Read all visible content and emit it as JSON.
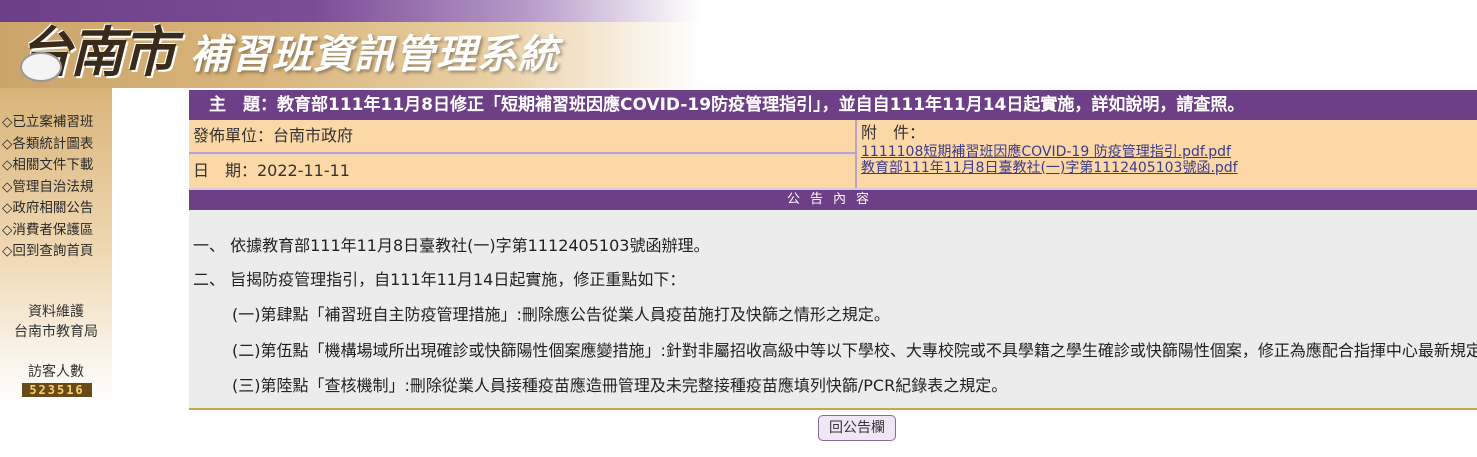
{
  "header": {
    "city_logo": "台南市",
    "system_title": "補習班資訊管理系統"
  },
  "sidebar": {
    "items": [
      {
        "label": "◇已立案補習班"
      },
      {
        "label": "◇各類統計圖表"
      },
      {
        "label": "◇相關文件下載"
      },
      {
        "label": "◇管理自治法規"
      },
      {
        "label": "◇政府相關公告"
      },
      {
        "label": "◇消費者保護區"
      },
      {
        "label": "◇回到查詢首頁"
      }
    ],
    "maintainer_label": "資料維護",
    "maintainer_name": "台南市教育局",
    "visitor_label": "訪客人數",
    "visitor_count": "523516"
  },
  "announcement": {
    "subject": "主　題：教育部111年11月8日修正「短期補習班因應COVID-19防疫管理指引」，並自自111年11月14日起實施，詳如說明，請查照。",
    "publisher": "發佈單位：台南市政府",
    "date": "日　期：2022-11-11",
    "attachment_label": "附　件：",
    "attachments": [
      "1111108短期補習班因應COVID-19 防疫管理指引.pdf.pdf",
      "教育部111年11月8日臺教社(一)字第1112405103號函.pdf"
    ],
    "content_header": "公告內容",
    "paragraphs": [
      "一、 依據教育部111年11月8日臺教社(一)字第1112405103號函辦理。",
      "二、 旨揭防疫管理指引，自111年11月14日起實施，修正重點如下：",
      "(一)第肆點「補習班自主防疫管理措施」:刪除應公告從業人員疫苗施打及快篩之情形之規定。",
      "(二)第伍點「機構場域所出現確診或快篩陽性個案應變措施」:針對非屬招收高級中等以下學校、大專校院或不具學籍之學生確診或快篩陽性個案，修正為應配合指揮中心最新規定。",
      "(三)第陸點「查核機制」:刪除從業人員接種疫苗應造冊管理及未完整接種疫苗應填列快篩/PCR紀錄表之規定。"
    ],
    "back_button": "回公告欄"
  },
  "colors": {
    "purple": "#6d3f86",
    "peach": "#fbd8a6",
    "content_bg": "#ececec"
  }
}
